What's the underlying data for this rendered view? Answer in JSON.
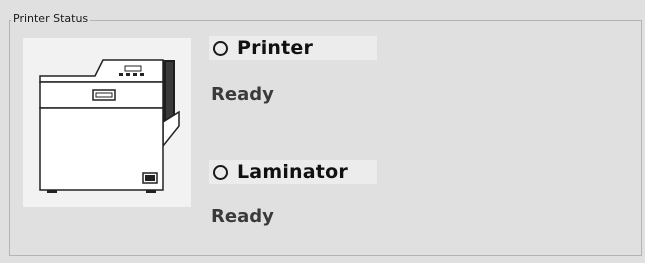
{
  "group": {
    "title": "Printer Status"
  },
  "printer": {
    "title": "Printer",
    "status": "Ready",
    "indicator_icon": "status-indicator-circle"
  },
  "laminator": {
    "title": "Laminator",
    "status": "Ready",
    "indicator_icon": "status-indicator-circle"
  },
  "image": {
    "icon": "card-printer-illustration"
  },
  "colors": {
    "panel_background": "#e0e0e0",
    "image_background": "#f2f2f2",
    "header_background": "#ececec",
    "text": "#111111"
  }
}
